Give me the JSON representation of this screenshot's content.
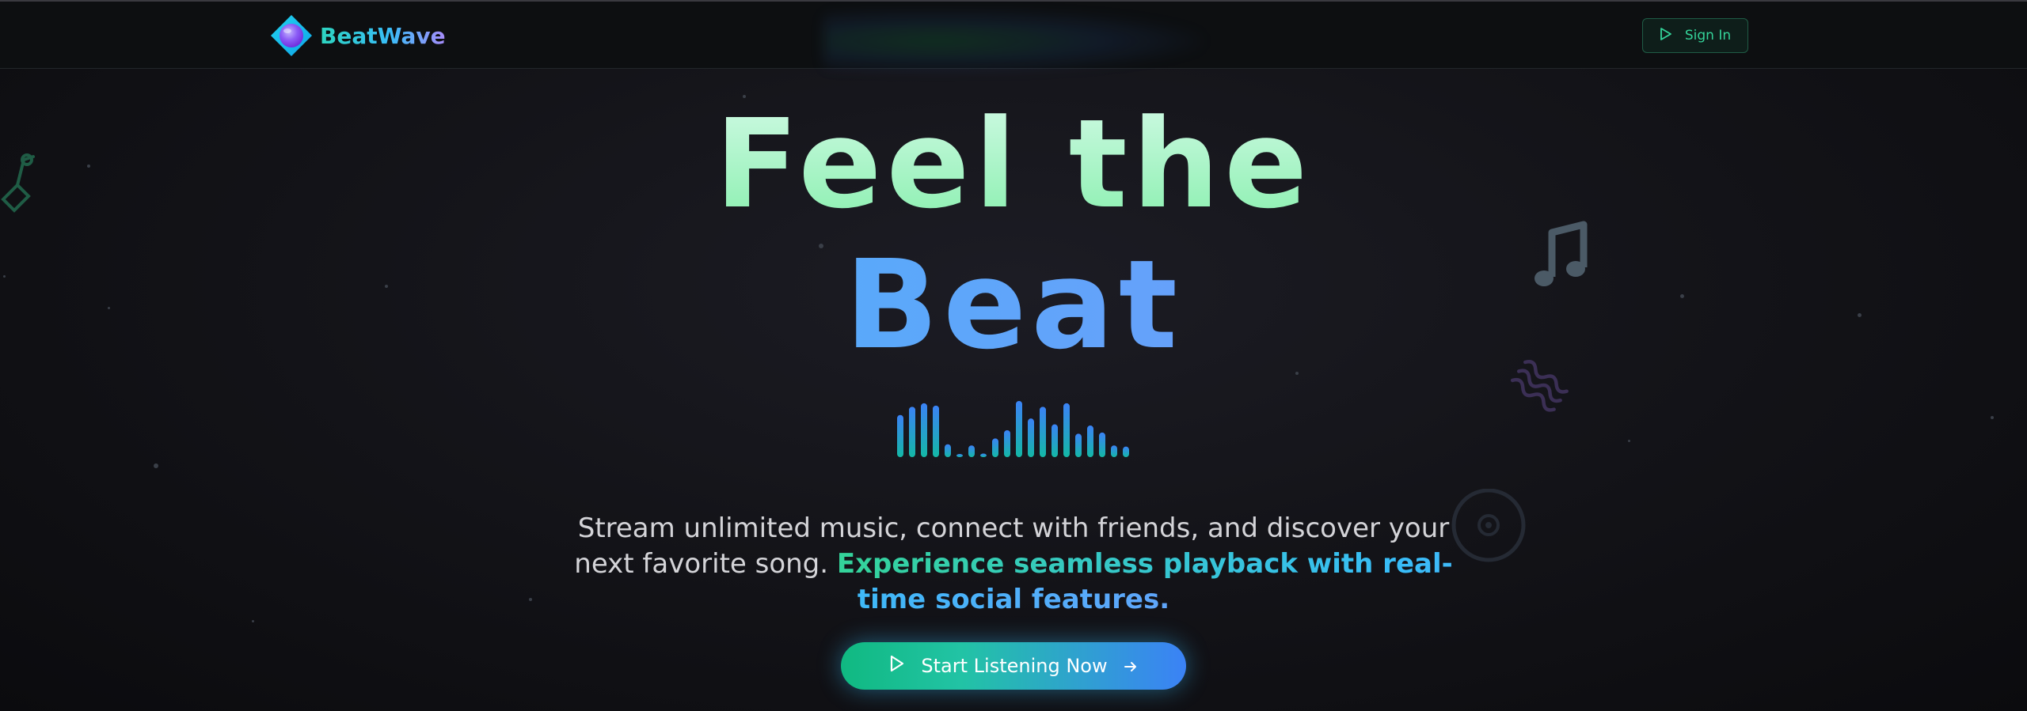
{
  "brand": {
    "name": "BeatWave"
  },
  "nav": {
    "signin_label": "Sign In"
  },
  "hero": {
    "line1": "Feel the",
    "line2": "Beat",
    "subtitle_plain": "Stream unlimited music, connect with friends, and discover your next favorite song.",
    "subtitle_highlight": "Experience seamless playback with real-time social features.",
    "cta_label": "Start Listening Now"
  },
  "icons": {
    "logo": "beatwave-logo-icon",
    "signin": "play-icon",
    "cta_play": "play-icon",
    "cta_arrow": "arrow-right-icon",
    "music_note": "music-note-icon",
    "wave": "sound-wave-icon",
    "vinyl": "vinyl-record-icon",
    "corner": "music-note-outline-icon"
  },
  "equalizer_levels": [
    0.72,
    0.86,
    0.92,
    0.88,
    0.22,
    0.0,
    0.2,
    0.06,
    0.32,
    0.46,
    0.96,
    0.66,
    0.86,
    0.56,
    0.92,
    0.4,
    0.54,
    0.42,
    0.2,
    0.18
  ],
  "colors": {
    "accent_green": "#10b981",
    "accent_blue": "#3b82f6",
    "title_green": "#86efac",
    "title_blue": "#60a5fa",
    "background": "#141419"
  }
}
